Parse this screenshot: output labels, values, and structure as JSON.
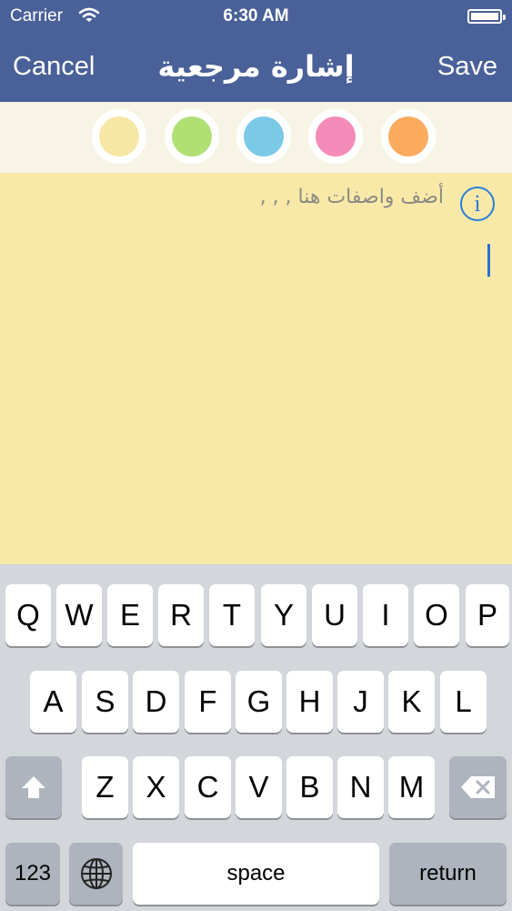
{
  "status_bar": {
    "carrier": "Carrier",
    "time": "6:30 AM"
  },
  "nav": {
    "cancel_label": "Cancel",
    "title": "إشارة مرجعية",
    "save_label": "Save"
  },
  "colors": [
    {
      "name": "yellow",
      "hex": "#f7e7a5"
    },
    {
      "name": "green",
      "hex": "#b0df74"
    },
    {
      "name": "blue",
      "hex": "#7ac9e6"
    },
    {
      "name": "pink",
      "hex": "#f48bb9"
    },
    {
      "name": "orange",
      "hex": "#fbaa5e"
    }
  ],
  "note": {
    "placeholder": "أضف واصفات هنا , , ,",
    "info_icon": "i"
  },
  "keyboard": {
    "row1": [
      "Q",
      "W",
      "E",
      "R",
      "T",
      "Y",
      "U",
      "I",
      "O",
      "P"
    ],
    "row2": [
      "A",
      "S",
      "D",
      "F",
      "G",
      "H",
      "J",
      "K",
      "L"
    ],
    "row3": [
      "Z",
      "X",
      "C",
      "V",
      "B",
      "N",
      "M"
    ],
    "numbers_label": "123",
    "space_label": "space",
    "return_label": "return",
    "shift_icon": "shift-icon",
    "delete_icon": "delete-icon",
    "globe_icon": "globe-icon"
  }
}
